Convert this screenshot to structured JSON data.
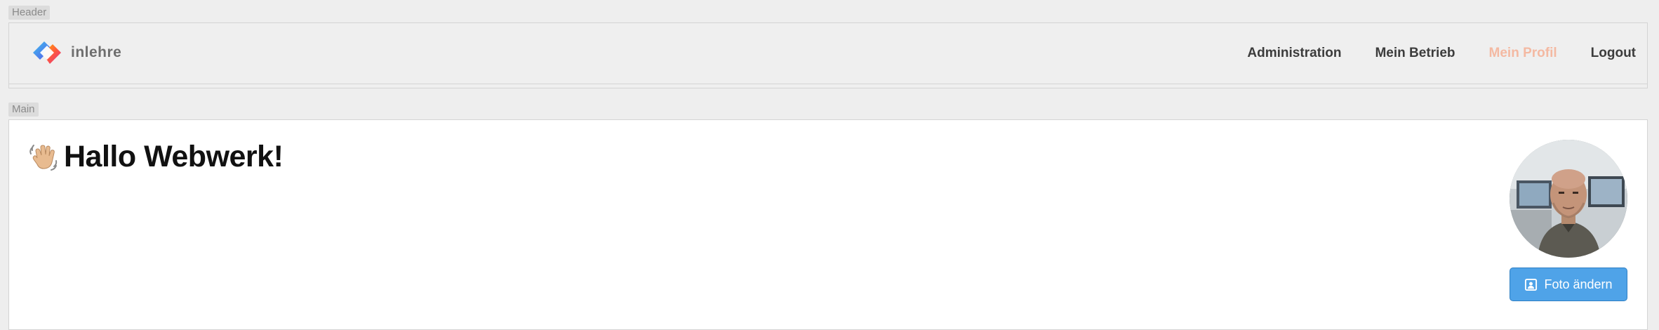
{
  "sections": {
    "header_tag": "Header",
    "main_tag": "Main"
  },
  "header": {
    "brand": "inlehre",
    "nav": [
      {
        "label": "Administration",
        "active": false
      },
      {
        "label": "Mein Betrieb",
        "active": false
      },
      {
        "label": "Mein Profil",
        "active": true
      },
      {
        "label": "Logout",
        "active": false
      }
    ]
  },
  "main": {
    "greeting": "Hallo Webwerk!",
    "greeting_icon": "waving-hand-icon",
    "avatar_icon": "profile-photo",
    "photo_button_label": "Foto ändern",
    "photo_button_icon": "portrait-icon"
  },
  "colors": {
    "active_nav": "#f4b9a2",
    "button_bg": "#4fa3e8",
    "background": "#eeeeee"
  }
}
